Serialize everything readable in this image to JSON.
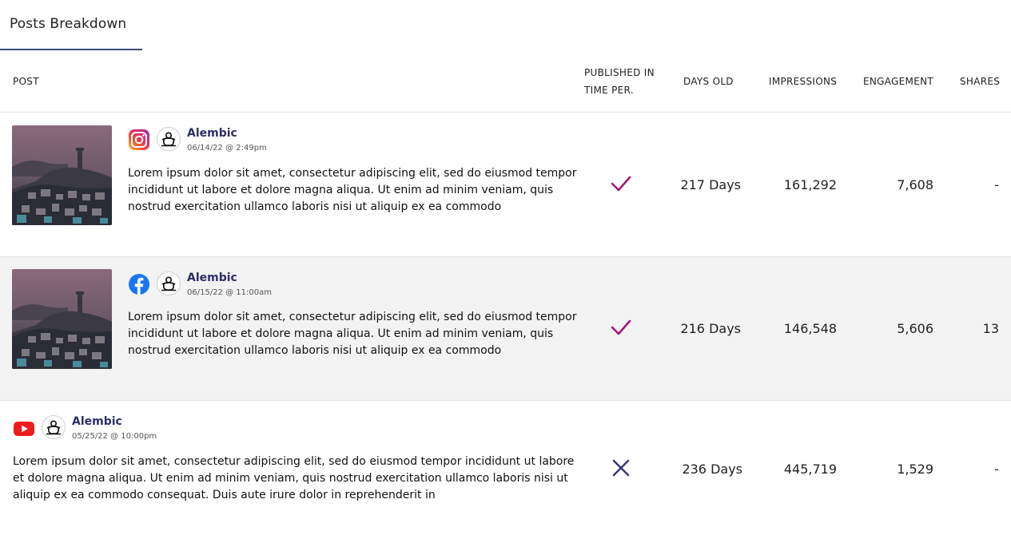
{
  "tabs": [
    {
      "label": "Posts Breakdown"
    }
  ],
  "table": {
    "columns": {
      "post": "POST",
      "published_line1": "PUBLISHED IN",
      "published_line2": "TIME PER.",
      "days_old": "DAYS OLD",
      "impressions": "IMPRESSIONS",
      "engagement": "ENGAGEMENT",
      "shares": "SHARES"
    },
    "rows": [
      {
        "network_icon": "instagram-icon",
        "avatar_icon": "alembic-logo-icon",
        "brand": "Alembic",
        "date": "06/14/22 @ 2:49pm",
        "text": "Lorem ipsum dolor sit amet, consectetur adipiscing elit, sed do eiusmod tempor incididunt ut labore et dolore magna aliqua. Ut enim ad minim veniam, quis nostrud exercitation ullamco laboris nisi ut aliquip ex ea commodo",
        "published_in_time": "check-icon",
        "days_old": "217 Days",
        "impressions": "161,292",
        "engagement": "7,608",
        "shares": "-"
      },
      {
        "network_icon": "facebook-icon",
        "avatar_icon": "alembic-logo-icon",
        "brand": "Alembic",
        "date": "06/15/22 @ 11:00am",
        "text": "Lorem ipsum dolor sit amet, consectetur adipiscing elit, sed do eiusmod tempor incididunt ut labore et dolore magna aliqua. Ut enim ad minim veniam, quis nostrud exercitation ullamco laboris nisi ut aliquip ex ea commodo",
        "published_in_time": "check-icon",
        "days_old": "216 Days",
        "impressions": "146,548",
        "engagement": "5,606",
        "shares": "13"
      },
      {
        "network_icon": "youtube-icon",
        "avatar_icon": "alembic-logo-icon",
        "brand": "Alembic",
        "date": "05/25/22 @ 10:00pm",
        "text": "Lorem ipsum dolor sit amet, consectetur adipiscing elit, sed do eiusmod tempor incididunt ut labore et dolore magna aliqua. Ut enim ad minim veniam, quis nostrud exercitation ullamco laboris nisi ut aliquip ex ea commodo consequat. Duis aute irure dolor in reprehenderit in",
        "published_in_time": "x-icon",
        "days_old": "236 Days",
        "impressions": "445,719",
        "engagement": "1,529",
        "shares": "-"
      }
    ]
  },
  "colors": {
    "brand_name": "#2d2f66",
    "tab_underline": "#3c4a7a",
    "check": "#a0187a",
    "cross": "#3a3a78",
    "alt_row": "#f3f3f3"
  }
}
